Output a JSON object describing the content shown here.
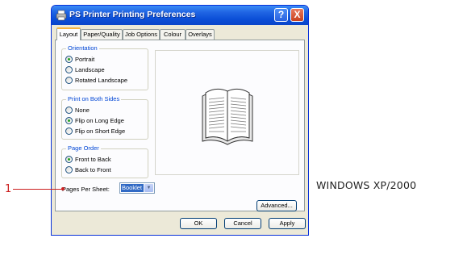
{
  "window": {
    "title": "PS Printer Printing Preferences",
    "help_button": "?",
    "close_button": "X"
  },
  "tabs": [
    {
      "label": "Layout",
      "active": true
    },
    {
      "label": "Paper/Quality",
      "active": false
    },
    {
      "label": "Job Options",
      "active": false
    },
    {
      "label": "Colour",
      "active": false
    },
    {
      "label": "Overlays",
      "active": false
    }
  ],
  "orientation": {
    "title": "Orientation",
    "options": [
      {
        "label": "Portrait",
        "selected": true
      },
      {
        "label": "Landscape",
        "selected": false
      },
      {
        "label": "Rotated Landscape",
        "selected": false
      }
    ]
  },
  "print_both_sides": {
    "title": "Print on Both Sides",
    "options": [
      {
        "label": "None",
        "selected": false
      },
      {
        "label": "Flip on Long Edge",
        "selected": true
      },
      {
        "label": "Flip on Short Edge",
        "selected": false
      }
    ]
  },
  "page_order": {
    "title": "Page Order",
    "options": [
      {
        "label": "Front to Back",
        "selected": true
      },
      {
        "label": "Back to Front",
        "selected": false
      }
    ]
  },
  "pages_per_sheet": {
    "label": "Pages Per Sheet:",
    "value": "Booklet"
  },
  "buttons": {
    "advanced": "Advanced...",
    "ok": "OK",
    "cancel": "Cancel",
    "apply": "Apply"
  },
  "callout": {
    "number": "1"
  },
  "os_label": "WINDOWS XP/2000",
  "colors": {
    "titlebar": "#0b4ed7",
    "group_label": "#0046d5",
    "callout": "#cc2020",
    "selection": "#316ac5"
  }
}
